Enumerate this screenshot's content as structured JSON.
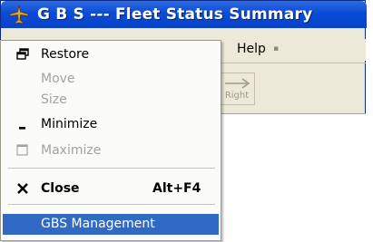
{
  "window": {
    "title": "G B S --- Fleet Status Summary",
    "accent_color": "#0a4cd6",
    "app_icon": "airplane-icon"
  },
  "menubar": {
    "help_label": "Help"
  },
  "toolbar": {
    "right_label": "Right"
  },
  "system_menu": {
    "items": [
      {
        "label": "Restore",
        "icon": "restore-icon",
        "enabled": true
      },
      {
        "label": "Move",
        "enabled": false
      },
      {
        "label": "Size",
        "enabled": false
      },
      {
        "label": "Minimize",
        "icon": "minimize-icon",
        "enabled": true
      },
      {
        "label": "Maximize",
        "icon": "maximize-icon",
        "enabled": false
      },
      {
        "label": "Close",
        "icon": "close-icon",
        "shortcut": "Alt+F4",
        "enabled": true
      },
      {
        "label": "GBS Management",
        "enabled": true,
        "highlighted": true
      }
    ],
    "highlight_color": "#316ac5"
  }
}
